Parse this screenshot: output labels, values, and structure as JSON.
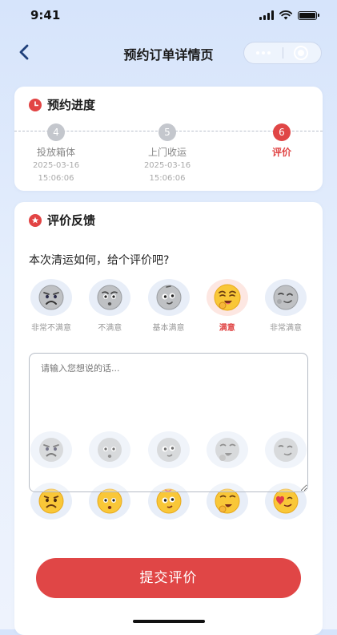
{
  "status_bar": {
    "time": "9:41"
  },
  "nav": {
    "title": "预约订单详情页"
  },
  "progress": {
    "title": "预约进度",
    "steps": [
      {
        "num": "4",
        "label": "投放箱体",
        "date": "2025-03-16",
        "time": "15:06:06",
        "active": false
      },
      {
        "num": "5",
        "label": "上门收运",
        "date": "2025-03-16",
        "time": "15:06:06",
        "active": false
      },
      {
        "num": "6",
        "label": "评价",
        "date": "",
        "time": "",
        "active": true
      }
    ]
  },
  "feedback": {
    "title": "评价反馈",
    "question": "本次清运如何，给个评价吧?",
    "ratings": [
      {
        "label": "非常不满意",
        "icon": "very-unsatisfied-emoji-icon"
      },
      {
        "label": "不满意",
        "icon": "unsatisfied-emoji-icon"
      },
      {
        "label": "基本满意",
        "icon": "basically-satisfied-emoji-icon"
      },
      {
        "label": "满意",
        "icon": "satisfied-emoji-icon",
        "selected": true
      },
      {
        "label": "非常满意",
        "icon": "very-satisfied-emoji-icon"
      }
    ],
    "textarea_placeholder": "请输入您想说的话..."
  },
  "submit": {
    "label": "提交评价"
  },
  "colors": {
    "accent": "#e04646",
    "card": "#ffffff",
    "background_top": "#d6e4fb"
  }
}
